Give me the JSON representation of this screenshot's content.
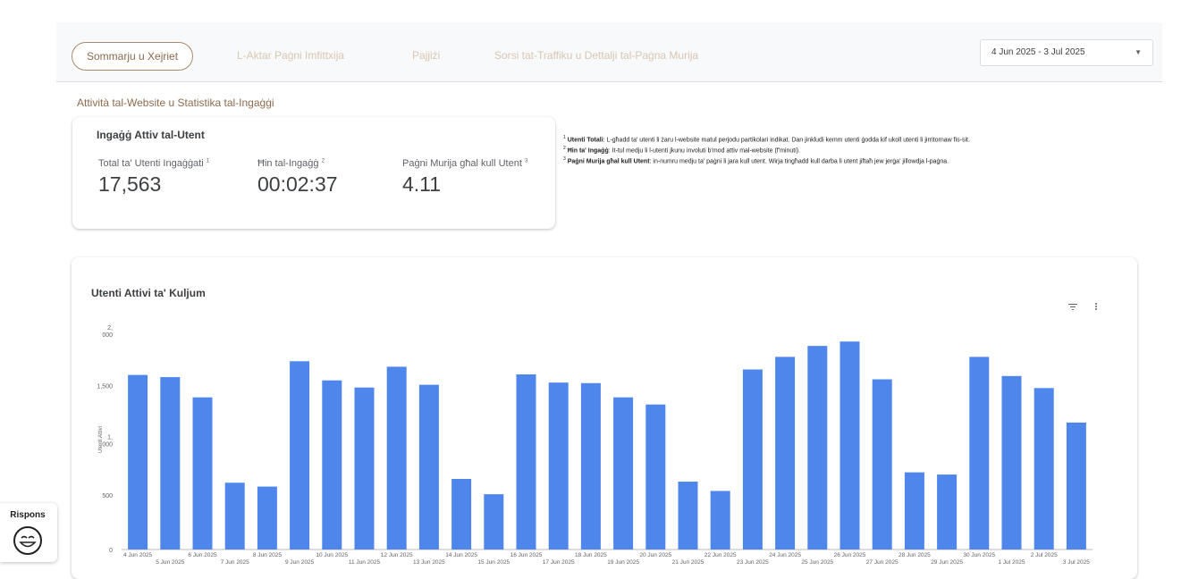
{
  "nav": {
    "tabs": [
      {
        "label": "Sommarju u Xejriet"
      },
      {
        "label": "L-Aktar Paġni Imfittxija"
      },
      {
        "label": "Pajjiżi"
      },
      {
        "label": "Sorsi tat-Traffiku u Dettalji tal-Paġna Murija"
      }
    ],
    "date_range": "4 Jun 2025 - 3 Jul 2025"
  },
  "section_title": "Attività tal-Website u Statistika tal-Ingaġġi",
  "kpi_card": {
    "title": "Ingaġġ Attiv tal-Utent",
    "metrics": [
      {
        "label": "Total ta' Utenti Ingaġġati",
        "sup": "1",
        "value": "17,563"
      },
      {
        "label": "Ħin tal-Ingaġġ",
        "sup": "2",
        "value": "00:02:37"
      },
      {
        "label": "Paġni Murija għal kull Utent",
        "sup": "3",
        "value": "4.11"
      }
    ]
  },
  "notes": [
    {
      "sup": "1",
      "term": "Utenti Totali",
      "text": ": L-għadd ta' utenti li żaru l-website matul perjodu partikolari indikat. Dan jinkludi kemm utenti ġodda kif ukoll utenti li jirritornaw fis-sit."
    },
    {
      "sup": "2",
      "term": "Ħin ta' Ingaġġ",
      "text": ": It-tul medju li l-utenti jkunu involuti b'mod attiv mal-website (f'minuti)."
    },
    {
      "sup": "3",
      "term": "Paġni Murija għal kull Utent",
      "text": ": in-numru medju ta' paġni li jara kull utent. Wirja tingħadd kull darba li utent jiftaħ jew jerġa' jillowdja l-paġna."
    }
  ],
  "chart_data": {
    "type": "bar",
    "title": "Utenti Attivi ta' Kuljum",
    "ylabel": "Utenti Attivi",
    "xlabel": "",
    "ylim": [
      0,
      2000
    ],
    "ytick_labels": [
      "0",
      "500",
      "1,\n000",
      "1,500",
      "2,\n000"
    ],
    "yticks": [
      0,
      500,
      1000,
      1500,
      2000
    ],
    "bar_color": "#4f86ec",
    "categories": [
      "4 Jun 2025",
      "5 Jun 2025",
      "6 Jun 2025",
      "7 Jun 2025",
      "8 Jun 2025",
      "9 Jun 2025",
      "10 Jun 2025",
      "11 Jun 2025",
      "12 Jun 2025",
      "13 Jun 2025",
      "14 Jun 2025",
      "15 Jun 2025",
      "16 Jun 2025",
      "17 Jun 2025",
      "18 Jun 2025",
      "19 Jun 2025",
      "20 Jun 2025",
      "21 Jun 2025",
      "22 Jun 2025",
      "23 Jun 2025",
      "24 Jun 2025",
      "25 Jun 2025",
      "26 Jun 2025",
      "27 Jun 2025",
      "28 Jun 2025",
      "29 Jun 2025",
      "30 Jun 2025",
      "1 Jul 2025",
      "2 Jul 2025",
      "3 Jul 2025"
    ],
    "values": [
      1595,
      1575,
      1390,
      610,
      575,
      1720,
      1545,
      1480,
      1670,
      1505,
      645,
      505,
      1600,
      1525,
      1520,
      1390,
      1325,
      620,
      535,
      1645,
      1760,
      1860,
      1900,
      1555,
      705,
      685,
      1760,
      1585,
      1475,
      1160
    ]
  },
  "response_button": {
    "label": "Rispons"
  }
}
